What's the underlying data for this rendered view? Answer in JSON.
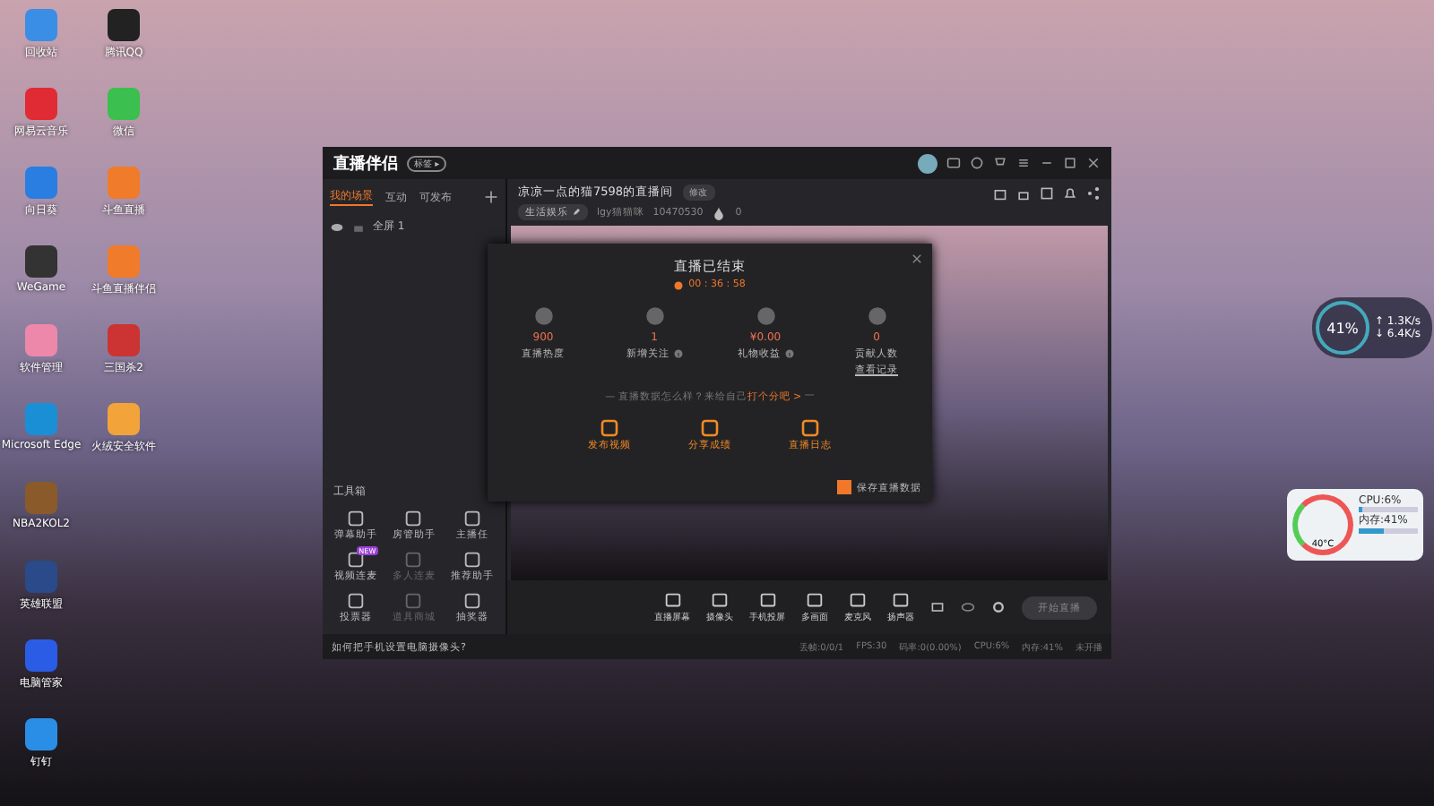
{
  "desktop_icons": [
    {
      "label": "回收站"
    },
    {
      "label": "网易云音乐"
    },
    {
      "label": "向日葵"
    },
    {
      "label": "WeGame"
    },
    {
      "label": "软件管理"
    },
    {
      "label": "Microsoft Edge"
    },
    {
      "label": "NBA2KOL2"
    },
    {
      "label": "英雄联盟"
    },
    {
      "label": "电脑管家"
    },
    {
      "label": "钉钉"
    },
    {
      "label": "腾讯QQ"
    },
    {
      "label": "微信"
    },
    {
      "label": "斗鱼直播"
    },
    {
      "label": "斗鱼直播伴侣"
    },
    {
      "label": "三国杀2"
    },
    {
      "label": "火绒安全软件"
    }
  ],
  "window": {
    "title": "直播伴侣",
    "badge": "标签 ▸"
  },
  "scene_tabs": [
    {
      "label": "我的场景",
      "selected": true
    },
    {
      "label": "互动",
      "selected": false
    },
    {
      "label": "可发布",
      "selected": false
    }
  ],
  "scene": {
    "name": "全屏 1"
  },
  "room": {
    "title": "凉凉一点的猫7598的直播间",
    "edit": "修改",
    "category": "生活娱乐",
    "streamer": "lgy猫猫咪",
    "room_id": "10470530",
    "heat": "0"
  },
  "toolbox": {
    "title": "工具箱",
    "tools": [
      {
        "label": "弹幕助手",
        "disabled": false
      },
      {
        "label": "房管助手",
        "disabled": false
      },
      {
        "label": "主播任",
        "disabled": false
      },
      {
        "label": "视频连麦",
        "disabled": false,
        "badge": "NEW"
      },
      {
        "label": "多人连麦",
        "disabled": true
      },
      {
        "label": "推荐助手",
        "disabled": false
      },
      {
        "label": "投票器",
        "disabled": false
      },
      {
        "label": "道具商城",
        "disabled": true
      },
      {
        "label": "抽奖器",
        "disabled": false
      }
    ]
  },
  "tip": "如何把手机设置电脑摄像头?",
  "summary": {
    "title": "直播已结束",
    "duration": "00 : 36 : 58",
    "stats": [
      {
        "value": "900",
        "label": "直播热度",
        "info": false
      },
      {
        "value": "1",
        "label": "新增关注",
        "info": true
      },
      {
        "value": "¥0.00",
        "label": "礼物收益",
        "info": true
      },
      {
        "value": "0",
        "label": "贡献人数",
        "info": false,
        "link": "查看记录"
      }
    ],
    "prompt": "— 直播数据怎么样？来给自己",
    "prompt_link": "打个分吧 >",
    "prompt_end": "—",
    "actions": [
      "发布视频",
      "分享成绩",
      "直播日志"
    ],
    "save": {
      "label": "保存直播数据",
      "checked": true
    }
  },
  "sources": [
    {
      "label": "直播屏幕"
    },
    {
      "label": "摄像头"
    },
    {
      "label": "手机投屏"
    },
    {
      "label": "多画面"
    },
    {
      "label": "麦克风"
    },
    {
      "label": "扬声器"
    }
  ],
  "start_button": "开始直播",
  "status_bar": [
    "丢帧:0/0/1",
    "FPS:30",
    "码率:0(0.00%)",
    "CPU:6%",
    "内存:41%",
    "未开播"
  ],
  "net_widget": {
    "percent": "41%",
    "up": "↑ 1.3K/s",
    "down": "↓ 6.4K/s"
  },
  "cpu_widget": {
    "temp": "40°C",
    "meters": [
      {
        "label": "CPU:6%",
        "level": 0.06
      },
      {
        "label": "内存:41%",
        "level": 0.41
      }
    ]
  }
}
